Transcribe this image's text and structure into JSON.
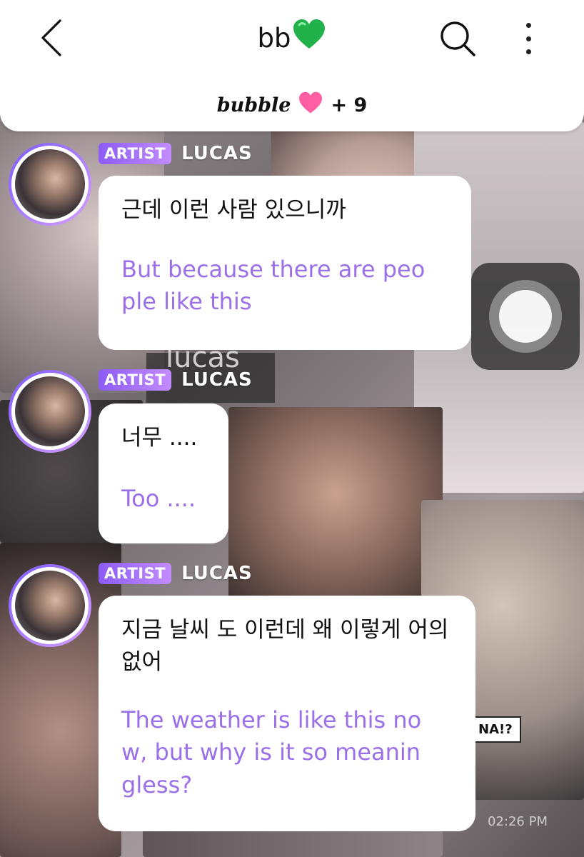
{
  "header": {
    "title": "bb",
    "title_emoji": "green-heart-icon",
    "subtitle_brand": "bubble",
    "subtitle_emoji": "pink-heart-icon",
    "subtitle_count": "+ 9"
  },
  "messages": [
    {
      "badge": "ARTIST",
      "sender": "LUCAS",
      "korean": "근데 이런 사람 있으니까",
      "english": "But because there are peo ple like this"
    },
    {
      "badge": "ARTIST",
      "sender": "LUCAS",
      "korean": "너무 ....",
      "english": "Too ...."
    },
    {
      "badge": "ARTIST",
      "sender": "LUCAS",
      "korean": "지금 날씨 도 이런데 왜 이렇게 어의 없어",
      "english": "The weather is like this no w, but why is it so meanin gless?"
    }
  ],
  "background": {
    "watermark_name": "lucas",
    "watermark_time": "02:26 PM",
    "sign_text": "NA!?"
  },
  "colors": {
    "accent_purple": "#9a6fe8",
    "badge_gradient_start": "#8b5cf6",
    "green_heart": "#22b24c",
    "pink_heart": "#ff5fa2"
  }
}
